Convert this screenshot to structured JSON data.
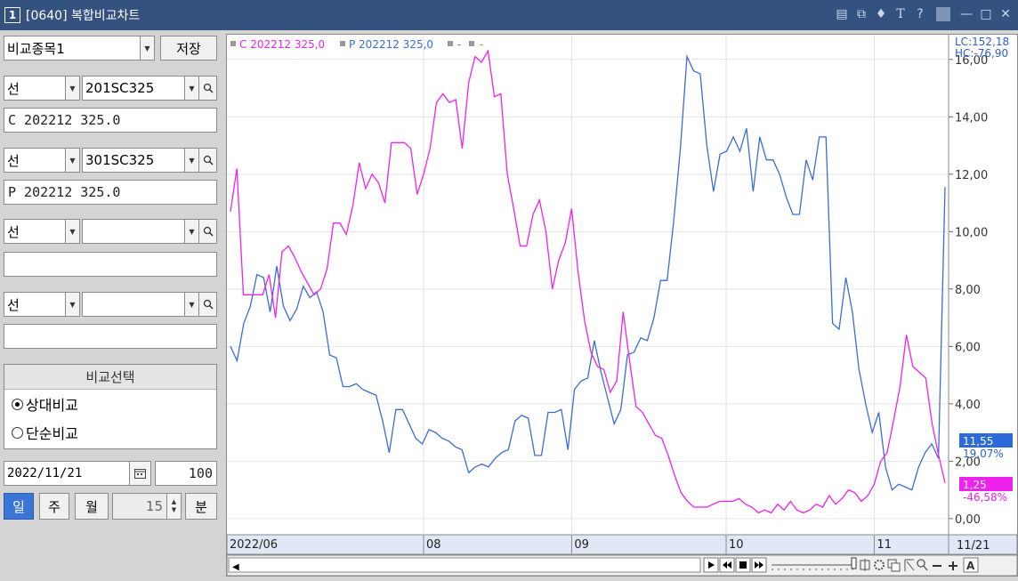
{
  "window": {
    "number": "1",
    "title": "[0640] 복합비교차트",
    "icons": [
      "restore-icon",
      "new-window-icon",
      "pin-icon",
      "font-icon",
      "help-icon",
      "minimize-icon",
      "maximize-icon",
      "close-icon"
    ]
  },
  "left_panel": {
    "group_combo": "비교종목1",
    "save_label": "저장",
    "rows": [
      {
        "type": "선",
        "code": "201SC325",
        "name": "C 202212 325.0"
      },
      {
        "type": "선",
        "code": "301SC325",
        "name": "P 202212 325.0"
      },
      {
        "type": "선",
        "code": "",
        "name": ""
      },
      {
        "type": "선",
        "code": "",
        "name": ""
      }
    ],
    "compare": {
      "title": "비교선택",
      "options": [
        {
          "label": "상대비교",
          "selected": true
        },
        {
          "label": "단순비교",
          "selected": false
        }
      ]
    },
    "date": "2022/11/21",
    "count": "100",
    "periods": {
      "day": "일",
      "week": "주",
      "month": "월",
      "minute_value": "15",
      "minute": "분"
    }
  },
  "colors": {
    "series_c": "#ee22ee",
    "series_p": "#3a6cd8",
    "title_bar": "#34527f",
    "active_tab": "#3b76d6"
  },
  "chart_data": {
    "type": "line",
    "legend": {
      "c": "C 202212 325,0",
      "p": "P 202212 325,0",
      "extra1": "-",
      "extra2": "-"
    },
    "top_right": {
      "lc": "LC:152,18",
      "hc": "HC:-76,90"
    },
    "yaxis": {
      "ticks": [
        "16,00",
        "14,00",
        "12,00",
        "10,00",
        "8,00",
        "6,00",
        "4,00",
        "2,00",
        "0,00"
      ],
      "ylim": [
        -0.5,
        16.8
      ]
    },
    "xaxis": {
      "ticks": [
        "2022/06",
        "08",
        "09",
        "10",
        "11"
      ],
      "last": "11/21"
    },
    "current_labels": {
      "p_value": "11,55",
      "p_change": "19,07%",
      "c_value": "1,25",
      "c_change": "-46,58%"
    },
    "series": [
      {
        "name": "C 202212 325,0",
        "values": [
          10.7,
          12.2,
          7.8,
          7.8,
          7.8,
          7.8,
          8.5,
          7.0,
          9.3,
          9.5,
          9.1,
          8.6,
          8.2,
          7.8,
          8.0,
          8.7,
          10.3,
          10.3,
          9.9,
          10.9,
          12.4,
          11.5,
          12.0,
          11.7,
          11.0,
          13.1,
          13.1,
          13.1,
          12.9,
          11.3,
          12.0,
          12.9,
          14.5,
          14.8,
          14.5,
          14.6,
          12.9,
          15.2,
          16.1,
          15.9,
          16.3,
          14.7,
          14.8,
          12.0,
          10.8,
          9.5,
          9.5,
          10.6,
          11.1,
          10.0,
          8.0,
          9.0,
          9.6,
          10.8,
          8.6,
          6.9,
          5.8,
          5.3,
          5.2,
          4.4,
          4.8,
          7.2,
          5.5,
          3.9,
          3.7,
          3.3,
          2.9,
          2.8,
          2.2,
          1.5,
          0.9,
          0.6,
          0.4,
          0.4,
          0.4,
          0.5,
          0.6,
          0.6,
          0.6,
          0.7,
          0.5,
          0.4,
          0.2,
          0.3,
          0.2,
          0.5,
          0.3,
          0.6,
          0.3,
          0.2,
          0.3,
          0.5,
          0.4,
          0.8,
          0.5,
          0.7,
          1.0,
          0.9,
          0.6,
          0.8,
          1.2,
          2.0,
          2.3,
          3.4,
          4.6,
          6.4,
          5.3,
          5.1,
          4.9,
          3.3,
          2.2,
          1.25
        ]
      },
      {
        "name": "P 202212 325,0",
        "values": [
          6.0,
          5.5,
          6.8,
          7.4,
          8.5,
          8.4,
          7.2,
          8.8,
          7.4,
          6.9,
          7.3,
          8.1,
          7.7,
          7.9,
          7.2,
          5.7,
          5.6,
          4.6,
          4.6,
          4.7,
          4.5,
          4.4,
          4.3,
          3.4,
          2.3,
          3.8,
          3.8,
          3.3,
          2.8,
          2.6,
          3.1,
          3.0,
          2.8,
          2.7,
          2.5,
          2.4,
          1.6,
          1.8,
          1.9,
          1.8,
          2.1,
          2.3,
          2.4,
          3.4,
          3.6,
          3.5,
          2.2,
          2.2,
          3.7,
          3.7,
          3.8,
          2.4,
          4.5,
          4.8,
          4.9,
          6.2,
          5.1,
          4.2,
          3.3,
          3.8,
          5.7,
          5.8,
          6.3,
          6.2,
          7.0,
          8.3,
          8.3,
          10.4,
          12.9,
          16.1,
          15.6,
          15.5,
          13.0,
          11.4,
          12.7,
          12.8,
          13.3,
          12.8,
          13.6,
          11.4,
          13.3,
          12.5,
          12.5,
          12.0,
          11.2,
          10.6,
          10.6,
          12.5,
          11.8,
          13.3,
          13.3,
          6.8,
          6.6,
          8.4,
          7.2,
          5.2,
          4.0,
          3.0,
          3.7,
          1.8,
          1.0,
          1.2,
          1.1,
          1.0,
          1.8,
          2.3,
          2.6,
          2.1,
          11.55
        ]
      }
    ]
  },
  "bottom_toolbar": {
    "controls": [
      "play-icon",
      "rewind-icon",
      "stop-icon",
      "fast-forward-icon",
      "slider-icon",
      "crosshair-icon",
      "settings-icon",
      "copy-icon",
      "line-tool-icon",
      "zoom-icon",
      "zoom-out-icon",
      "zoom-in-icon",
      "auto-icon"
    ],
    "auto_label": "A"
  }
}
